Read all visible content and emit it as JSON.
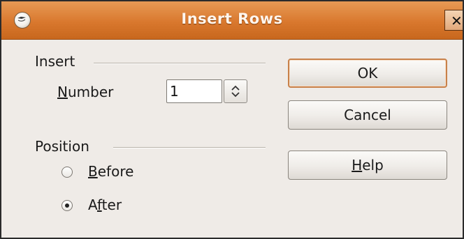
{
  "window": {
    "title": "Insert Rows",
    "close_glyph": "✕"
  },
  "insert_section": {
    "header": "Insert",
    "number_label_mnemonic": "N",
    "number_label_rest": "umber",
    "number_value": "1"
  },
  "position_section": {
    "header": "Position",
    "options": [
      {
        "mnemonic": "B",
        "rest": "efore",
        "checked": false
      },
      {
        "prefix": "A",
        "mnemonic": "f",
        "rest": "ter",
        "checked": true
      }
    ]
  },
  "buttons": {
    "ok": "OK",
    "cancel": "Cancel",
    "help_mnemonic": "H",
    "help_rest": "elp"
  },
  "icons": {
    "app": "office-app-icon",
    "close": "close-icon",
    "spin": "spin-arrows-icon"
  },
  "colors": {
    "titlebar": "#d9782e",
    "dialog_bg": "#efebe7",
    "default_button_border": "#c8814a"
  }
}
